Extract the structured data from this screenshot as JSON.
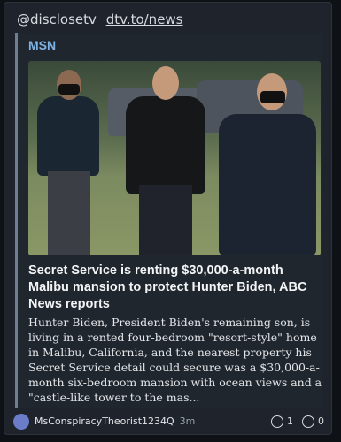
{
  "handles": {
    "account": "@disclosetv",
    "link": "dtv.to/news"
  },
  "card": {
    "source": "MSN",
    "headline": "Secret Service is renting $30,000-a-month Malibu mansion to protect Hunter Biden, ABC News reports",
    "excerpt": "Hunter Biden, President Biden's remaining son, is living in a rented four-bedroom \"resort-style\" home in Malibu, California, and the nearest property his Secret Service detail could secure was a $30,000-a-month six-bedroom mansion with ocean views and a \"castle-like tower to the mas..."
  },
  "footer": {
    "username": "MsConspiracyTheorist1234Q",
    "time": "3m",
    "likes": "1",
    "comments": "0"
  },
  "icons": {
    "avatar": "avatar-icon",
    "like": "smile-icon",
    "comment": "comment-icon"
  },
  "colors": {
    "source": "#7fb3e3",
    "accent_bar": "#6f7f8f",
    "background": "#1f242c"
  }
}
